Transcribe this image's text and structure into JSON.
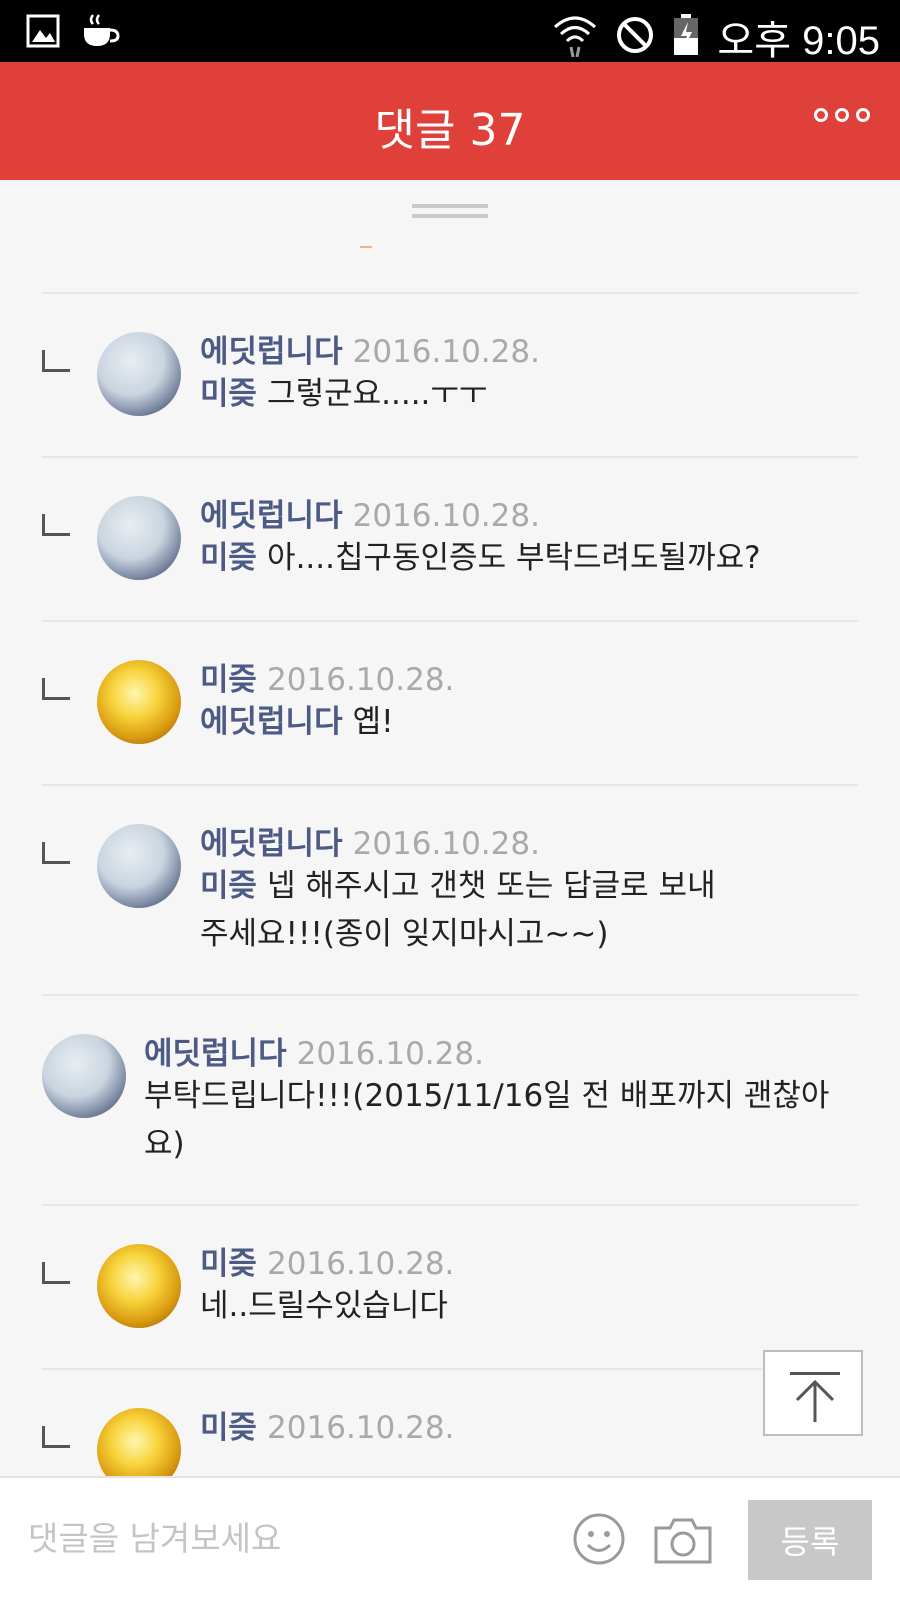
{
  "status_bar": {
    "time": "오후 9:05",
    "icons": [
      "image-icon",
      "coffee-cup-icon",
      "wifi-icon",
      "do-not-disturb-icon",
      "battery-icon"
    ]
  },
  "header": {
    "title": "댓글 37",
    "more_icon": "more-dots-icon",
    "background": "#e0403a"
  },
  "comments": [
    {
      "is_reply": true,
      "avatar": "avatar-anime-group",
      "author": "에딧럽니다",
      "date": "2016.10.28.",
      "mention": "미즞",
      "text": "그렇군요.....ㅜㅜ"
    },
    {
      "is_reply": true,
      "avatar": "avatar-anime-group",
      "author": "에딧럽니다",
      "date": "2016.10.28.",
      "mention": "미즞",
      "text": "아....칩구동인증도 부탁드려도될까요?"
    },
    {
      "is_reply": true,
      "avatar": "avatar-golden-character",
      "author": "미즞",
      "date": "2016.10.28.",
      "mention": "에딧럽니다",
      "text": "옙!"
    },
    {
      "is_reply": true,
      "avatar": "avatar-anime-group",
      "author": "에딧럽니다",
      "date": "2016.10.28.",
      "mention": "미즞",
      "text": "넵 해주시고 갠챗 또는 답글로 보내주세요!!!(종이 잊지마시고~~)"
    },
    {
      "is_reply": false,
      "avatar": "avatar-anime-group",
      "author": "에딧럽니다",
      "date": "2016.10.28.",
      "mention": "",
      "text": "부탁드립니다!!!(2015/11/16일 전 배포까지 괜찮아요)"
    },
    {
      "is_reply": true,
      "avatar": "avatar-golden-character",
      "author": "미즞",
      "date": "2016.10.28.",
      "mention": "",
      "text": "네..드릴수있습니다"
    },
    {
      "is_reply": true,
      "avatar": "avatar-golden-character",
      "author": "미즞",
      "date": "2016.10.28.",
      "mention": "",
      "text": ""
    }
  ],
  "scroll_top_icon": "arrow-up-to-top-icon",
  "input_bar": {
    "placeholder": "댓글을 남겨보세요",
    "emoji_icon": "smiley-icon",
    "camera_icon": "camera-icon",
    "submit_label": "등록"
  }
}
